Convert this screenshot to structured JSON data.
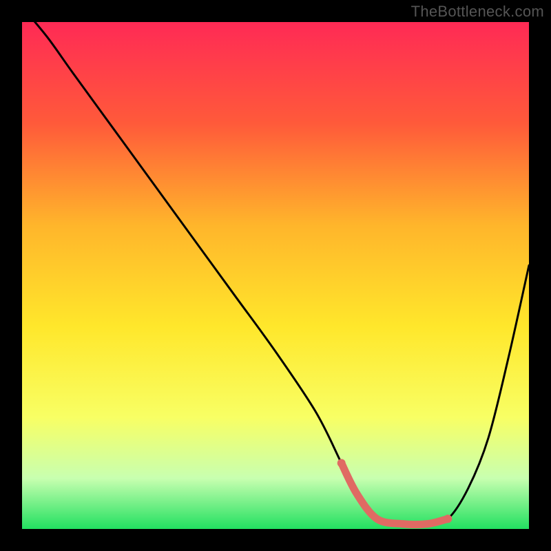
{
  "watermark": "TheBottleneck.com",
  "chart_data": {
    "type": "line",
    "title": "",
    "xlabel": "",
    "ylabel": "",
    "xlim": [
      0,
      100
    ],
    "ylim": [
      0,
      100
    ],
    "gradient_stops": [
      {
        "offset": 0,
        "color": "#ff2a55"
      },
      {
        "offset": 20,
        "color": "#ff5a3a"
      },
      {
        "offset": 40,
        "color": "#ffb52b"
      },
      {
        "offset": 60,
        "color": "#ffe72b"
      },
      {
        "offset": 78,
        "color": "#f8ff64"
      },
      {
        "offset": 90,
        "color": "#c8ffb0"
      },
      {
        "offset": 100,
        "color": "#22e060"
      }
    ],
    "series": [
      {
        "name": "bottleneck-curve",
        "x": [
          0,
          5,
          10,
          18,
          26,
          34,
          42,
          50,
          58,
          63,
          66,
          70,
          75,
          80,
          84,
          88,
          92,
          96,
          100
        ],
        "values": [
          103,
          97,
          90,
          79,
          68,
          57,
          46,
          35,
          23,
          13,
          7,
          2,
          1,
          1,
          2,
          8,
          18,
          34,
          52
        ]
      }
    ],
    "accent_segment": {
      "name": "optimal-range",
      "x": [
        63,
        66,
        70,
        75,
        80,
        84
      ],
      "values": [
        13,
        7,
        2,
        1,
        1,
        2
      ],
      "color": "#e06a63"
    },
    "curve_color": "#000000",
    "background": "#000000"
  }
}
